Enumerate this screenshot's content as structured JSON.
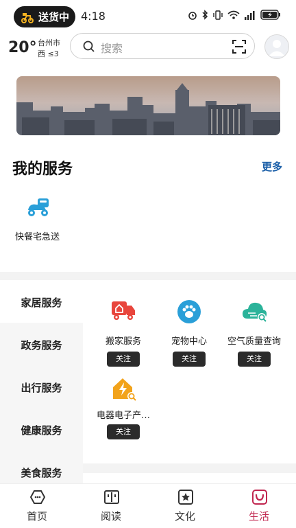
{
  "status_bar": {
    "pill_label": "送货中",
    "time": "4:18",
    "battery_color": "#222222"
  },
  "header": {
    "temperature": "20°",
    "city": "台州市",
    "wind": "西  ≤3",
    "search_placeholder": "搜索"
  },
  "my_services": {
    "title": "我的服务",
    "more_label": "更多",
    "items": [
      {
        "label": "快餐宅急送",
        "icon": "scooter-icon",
        "color": "#2a9fd8"
      }
    ]
  },
  "categories": {
    "items": [
      {
        "label": "家居服务"
      },
      {
        "label": "政务服务"
      },
      {
        "label": "出行服务"
      },
      {
        "label": "健康服务"
      },
      {
        "label": "美食服务"
      }
    ],
    "active_index": 0
  },
  "services": {
    "follow_label": "关注",
    "items": [
      {
        "label": "搬家服务",
        "icon": "moving-truck-icon",
        "color": "#e8453c"
      },
      {
        "label": "宠物中心",
        "icon": "paw-icon",
        "color": "#2a9fd8"
      },
      {
        "label": "空气质量查询",
        "icon": "cloud-search-icon",
        "color": "#2bb39a"
      },
      {
        "label": "电器电子产…",
        "icon": "house-bolt-icon",
        "color": "#f2a31b"
      }
    ]
  },
  "bottom_nav": {
    "items": [
      {
        "label": "首页",
        "icon": "home-icon"
      },
      {
        "label": "阅读",
        "icon": "book-icon"
      },
      {
        "label": "文化",
        "icon": "star-icon"
      },
      {
        "label": "生活",
        "icon": "bag-icon"
      }
    ],
    "active_index": 3,
    "active_color": "#c0264f"
  }
}
